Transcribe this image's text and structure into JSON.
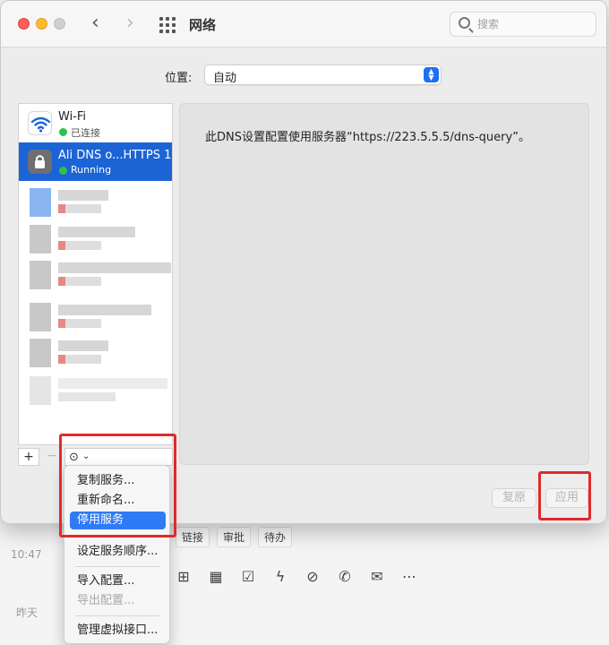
{
  "window": {
    "title": "网络",
    "search_placeholder": "搜索"
  },
  "location": {
    "label": "位置:",
    "value": "自动"
  },
  "services": [
    {
      "name": "Wi-Fi",
      "status": "已连接",
      "icon": "wifi-icon",
      "selected": false
    },
    {
      "name": "Ali DNS o...HTTPS 1",
      "status": "Running",
      "icon": "lock-icon",
      "selected": true
    }
  ],
  "list_toolbar": {
    "add": "+",
    "remove": "−",
    "more": "⊙",
    "more_chevron": "⌄"
  },
  "detail": {
    "text": "此DNS设置配置使用服务器“https://223.5.5.5/dns-query”。"
  },
  "buttons": {
    "revert": "复原",
    "apply": "应用"
  },
  "menu": {
    "items": [
      {
        "label": "复制服务...",
        "state": "normal"
      },
      {
        "label": "重新命名...",
        "state": "normal"
      },
      {
        "label": "停用服务",
        "state": "active"
      },
      {
        "label": "设定服务顺序...",
        "state": "normal"
      },
      {
        "label": "导入配置...",
        "state": "normal"
      },
      {
        "label": "导出配置...",
        "state": "disabled"
      },
      {
        "label": "管理虚拟接口...",
        "state": "normal"
      }
    ]
  },
  "background_app": {
    "time": "10:47",
    "yesterday": "昨天",
    "tags": [
      "链接",
      "审批",
      "待办"
    ],
    "toolbar_icons": [
      "add-folder-icon",
      "calendar-icon",
      "checkbox-icon",
      "lightning-icon",
      "link-icon",
      "phone-icon",
      "mail-icon",
      "more-icon"
    ]
  },
  "colors": {
    "selection": "#1c64d6",
    "menu_highlight": "#2f7bf5",
    "status_green": "#2fc04a",
    "annotation_red": "#e02a2a"
  }
}
